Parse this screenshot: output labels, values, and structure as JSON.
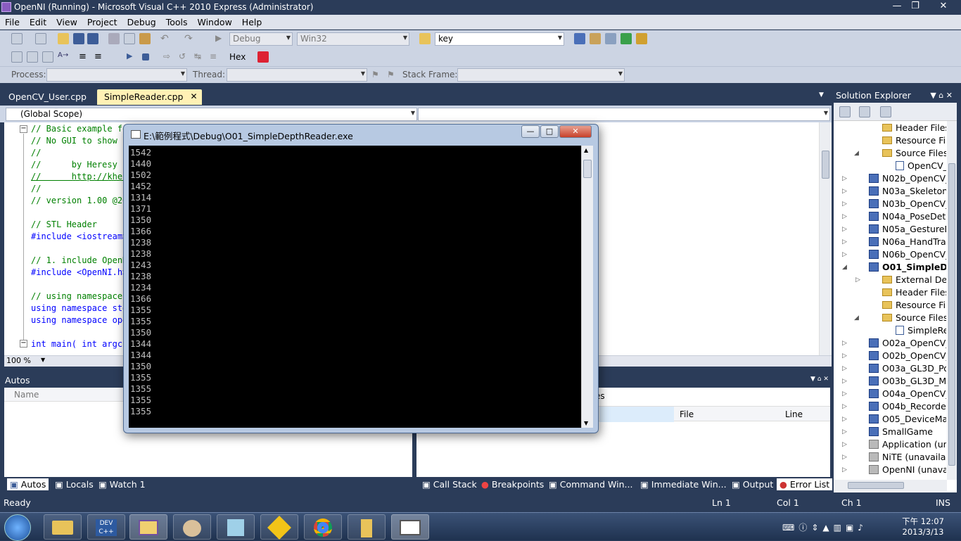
{
  "window": {
    "title": "OpenNI (Running) - Microsoft Visual C++ 2010 Express (Administrator)"
  },
  "menu": [
    "File",
    "Edit",
    "View",
    "Project",
    "Debug",
    "Tools",
    "Window",
    "Help"
  ],
  "toolbar": {
    "config": "Debug",
    "platform": "Win32",
    "find_value": "key",
    "hex_label": "Hex",
    "process_label": "Process:",
    "thread_label": "Thread:",
    "stack_frame_label": "Stack Frame:"
  },
  "editor": {
    "tabs": [
      {
        "label": "OpenCV_User.cpp"
      },
      {
        "label": "SimpleReader.cpp"
      }
    ],
    "scope": "(Global Scope)",
    "zoom": "100 %",
    "lines": [
      "// Basic example fo",
      "// No GUI to show i",
      "//",
      "//      by Heresy",
      "//      http://kher",
      "//",
      "// version 1.00 @20",
      "",
      "// STL Header",
      "#include <iostream>",
      "",
      "// 1. include OpenN",
      "#include <OpenNI.h>",
      "",
      "// using namespace",
      "using namespace std",
      "using namespace ope",
      "",
      "int main( int argc,"
    ]
  },
  "console": {
    "title": "E:\\範例程式\\Debug\\O01_SimpleDepthReader.exe",
    "lines": [
      "1542",
      "1440",
      "1502",
      "1452",
      "1314",
      "1371",
      "1350",
      "1366",
      "1238",
      "1238",
      "1243",
      "1238",
      "1234",
      "1366",
      "1355",
      "1355",
      "1350",
      "1344",
      "1344",
      "1350",
      "1355",
      "1355",
      "1355",
      "1355"
    ]
  },
  "autos": {
    "title": "Autos",
    "column": "Name"
  },
  "errorlist": {
    "partial_title": "es",
    "columns": [
      "File",
      "Line"
    ]
  },
  "bottom_tabs_left": [
    "Autos",
    "Locals",
    "Watch 1"
  ],
  "bottom_tabs_right": [
    "Call Stack",
    "Breakpoints",
    "Command Win...",
    "Immediate Win...",
    "Output",
    "Error List"
  ],
  "solution_explorer": {
    "title": "Solution Explorer",
    "items": [
      {
        "label": "Header Files",
        "type": "folder",
        "indent": 1
      },
      {
        "label": "Resource Files",
        "type": "folder",
        "indent": 1
      },
      {
        "label": "Source Files",
        "type": "folder",
        "indent": 1
      },
      {
        "label": "OpenCV_Us",
        "type": "cpp",
        "indent": 2
      },
      {
        "label": "N02b_OpenCV_Us",
        "type": "proj",
        "indent": 0
      },
      {
        "label": "N03a_Skeleton",
        "type": "proj",
        "indent": 0
      },
      {
        "label": "N03b_OpenCV_Ske",
        "type": "proj",
        "indent": 0
      },
      {
        "label": "N04a_PoseDetecti",
        "type": "proj",
        "indent": 0
      },
      {
        "label": "N05a_GestureDete",
        "type": "proj",
        "indent": 0
      },
      {
        "label": "N06a_HandTrackin",
        "type": "proj",
        "indent": 0
      },
      {
        "label": "N06b_OpenCV_Ha",
        "type": "proj",
        "indent": 0
      },
      {
        "label": "O01_SimpleDepth",
        "type": "proj",
        "indent": 0
      },
      {
        "label": "External Depen",
        "type": "folder",
        "indent": 1
      },
      {
        "label": "Header Files",
        "type": "folder",
        "indent": 1
      },
      {
        "label": "Resource Files",
        "type": "folder",
        "indent": 1
      },
      {
        "label": "Source Files",
        "type": "folder",
        "indent": 1
      },
      {
        "label": "SimpleRead",
        "type": "cpp",
        "indent": 2
      },
      {
        "label": "O02a_OpenCV_Vie",
        "type": "proj",
        "indent": 0
      },
      {
        "label": "O02b_OpenCV_Vie",
        "type": "proj",
        "indent": 0
      },
      {
        "label": "O03a_GL3D_Point",
        "type": "proj",
        "indent": 0
      },
      {
        "label": "O03b_GL3D_Mesh",
        "type": "proj",
        "indent": 0
      },
      {
        "label": "O04a_OpenCV_Pla",
        "type": "proj",
        "indent": 0
      },
      {
        "label": "O04b_Recorder",
        "type": "proj",
        "indent": 0
      },
      {
        "label": "O05_DeviceManag",
        "type": "proj",
        "indent": 0
      },
      {
        "label": "SmallGame",
        "type": "proj",
        "indent": 0
      },
      {
        "label": "Application (unava",
        "type": "gray",
        "indent": 0
      },
      {
        "label": "NiTE (unavailable)",
        "type": "gray",
        "indent": 0
      },
      {
        "label": "OpenNI (unavailab",
        "type": "gray",
        "indent": 0
      }
    ]
  },
  "status": {
    "ready": "Ready",
    "ln": "Ln 1",
    "col": "Col 1",
    "ch": "Ch 1",
    "ins": "INS"
  },
  "taskbar": {
    "time": "下午 12:07",
    "date": "2013/3/13"
  }
}
